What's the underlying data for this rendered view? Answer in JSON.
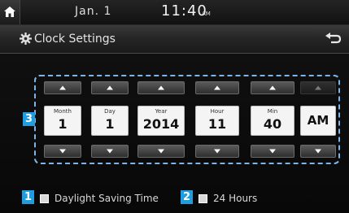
{
  "status_bar": {
    "date": "Jan.  1",
    "time": "11:40",
    "ampm": "AM",
    "home_icon": "home-icon"
  },
  "title_bar": {
    "title": "Clock Settings",
    "settings_icon": "gear-icon",
    "back_icon": "back-arrow-icon"
  },
  "picker": {
    "callout": "3",
    "fields": [
      {
        "label": "Month",
        "value": "1"
      },
      {
        "label": "Day",
        "value": "1"
      },
      {
        "label": "Year",
        "value": "2014"
      },
      {
        "label": "Hour",
        "value": "11"
      },
      {
        "label": "Min",
        "value": "40"
      },
      {
        "label": "",
        "value": "AM"
      }
    ]
  },
  "options": {
    "daylight": {
      "callout": "1",
      "label": "Daylight Saving Time"
    },
    "hours24": {
      "callout": "2",
      "label": "24 Hours"
    }
  },
  "colors": {
    "accent_callout": "#1e9ee0",
    "picker_border": "#7db5ea"
  }
}
